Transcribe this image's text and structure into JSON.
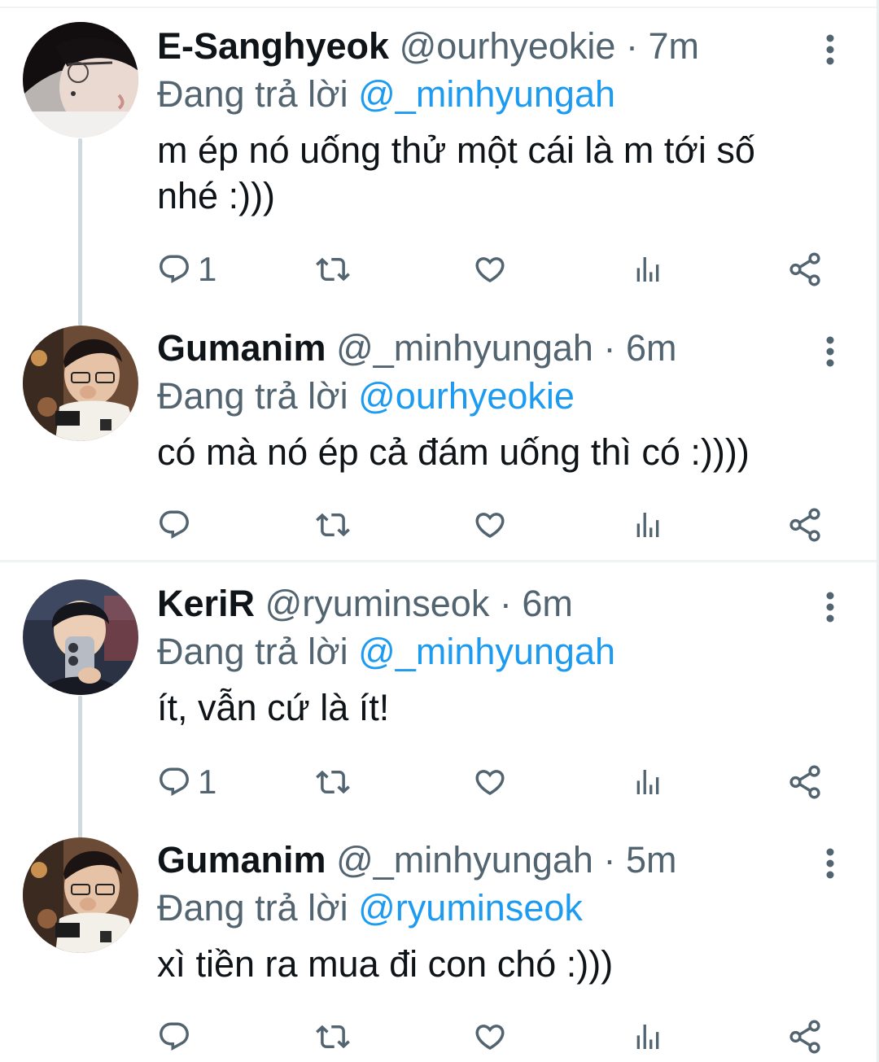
{
  "tweets": [
    {
      "display_name": "E-Sanghyeok",
      "handle": "@ourhyeokie",
      "separator": "·",
      "time": "7m",
      "reply_prefix": "Đang trả lời",
      "reply_to": "@_minhyungah",
      "text": "m ép nó uống thử một cái là m tới số nhé :)))",
      "reply_count": "1",
      "avatar_icon": "profile-photo-icon"
    },
    {
      "display_name": "Gumanim",
      "handle": "@_minhyungah",
      "separator": "·",
      "time": "6m",
      "reply_prefix": "Đang trả lời",
      "reply_to": "@ourhyeokie",
      "text": "có mà nó ép cả đám uống thì có :))))",
      "reply_count": "",
      "avatar_icon": "profile-photo-icon"
    },
    {
      "display_name": "KeriR",
      "handle": "@ryuminseok",
      "separator": "·",
      "time": "6m",
      "reply_prefix": "Đang trả lời",
      "reply_to": "@_minhyungah",
      "text": "ít, vẫn cứ là ít!",
      "reply_count": "1",
      "avatar_icon": "profile-photo-icon"
    },
    {
      "display_name": "Gumanim",
      "handle": "@_minhyungah",
      "separator": "·",
      "time": "5m",
      "reply_prefix": "Đang trả lời",
      "reply_to": "@ryuminseok",
      "text": "xì tiền ra mua đi con chó :)))",
      "reply_count": "",
      "avatar_icon": "profile-photo-icon"
    }
  ],
  "actions": [
    "reply-icon",
    "retweet-icon",
    "like-icon",
    "views-icon",
    "share-icon"
  ],
  "colors": {
    "accent": "#1d9bf0",
    "secondary_text": "#536471",
    "primary_text": "#0f1419",
    "thread_line": "#cfd9de",
    "divider": "#eff3f4"
  }
}
